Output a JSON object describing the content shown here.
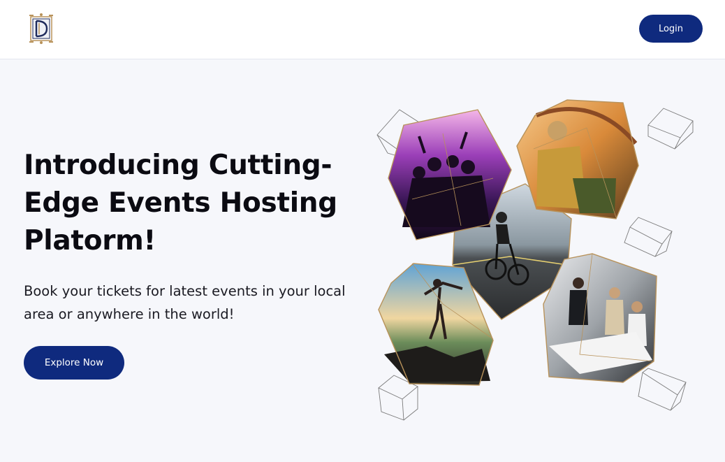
{
  "header": {
    "logo_icon": "monogram-crest-icon",
    "login_label": "Login"
  },
  "hero": {
    "title": "Introducing Cutting-Edge Events Hosting Platorm!",
    "subtitle": "Book your tickets for latest events in your local area or anywhere in the world!",
    "cta_label": "Explore Now"
  },
  "illustration": {
    "photos": [
      "concert-crowd-photo",
      "camping-sunset-photo",
      "road-cyclist-photo",
      "hiker-summit-photo",
      "business-meeting-photo"
    ],
    "decorations": [
      "wireframe-cube-icon"
    ]
  },
  "colors": {
    "primary": "#0f2a7e",
    "gold": "#b8925a",
    "background": "#f6f7fb"
  }
}
